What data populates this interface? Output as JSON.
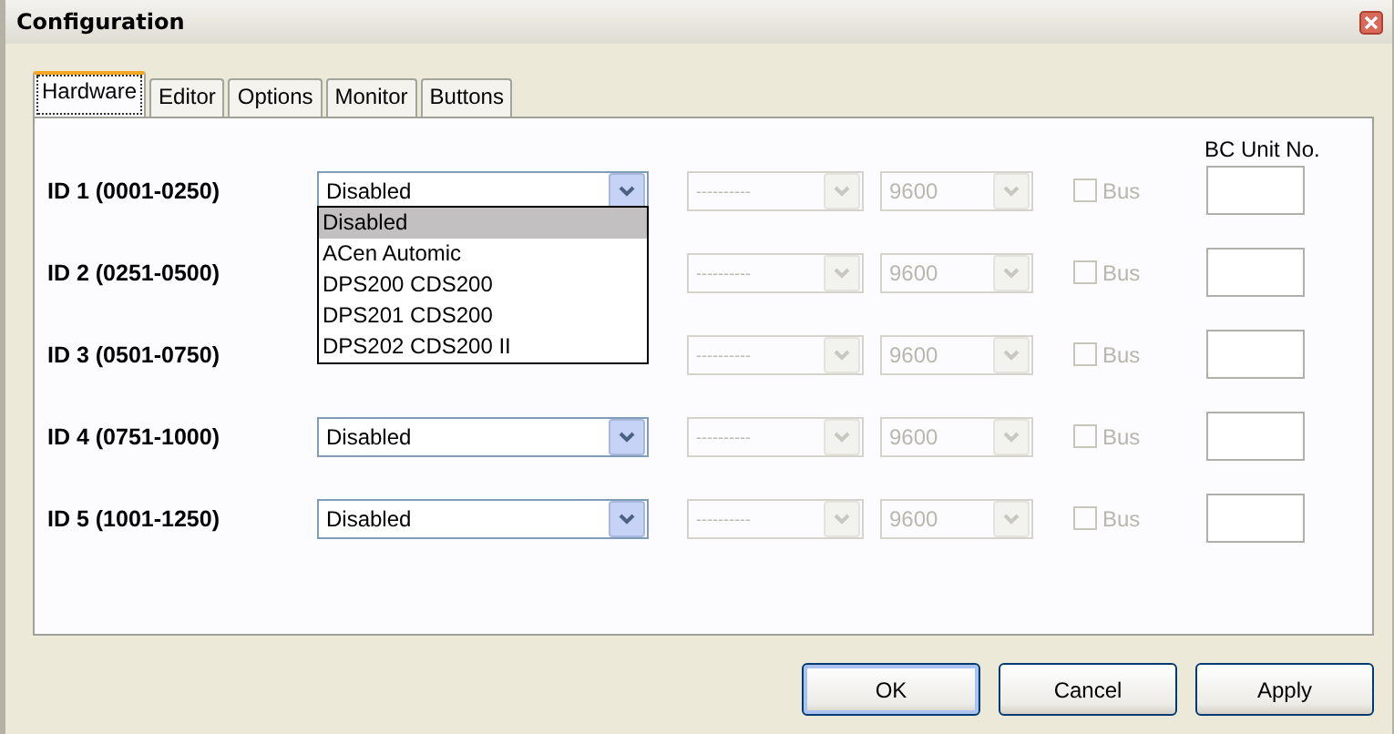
{
  "window": {
    "title": "Configuration"
  },
  "tabs": [
    {
      "label": "Hardware",
      "selected": true
    },
    {
      "label": "Editor",
      "selected": false
    },
    {
      "label": "Options",
      "selected": false
    },
    {
      "label": "Monitor",
      "selected": false
    },
    {
      "label": "Buttons",
      "selected": false
    }
  ],
  "column_header": "BC Unit No.",
  "rows": [
    {
      "label": "ID 1 (0001-0250)",
      "value": "Disabled",
      "expanded": true,
      "options": [
        {
          "label": "Disabled",
          "selected": true
        },
        {
          "label": "ACen Automic",
          "selected": false
        },
        {
          "label": "DPS200 CDS200",
          "selected": false
        },
        {
          "label": "DPS201 CDS200",
          "selected": false
        },
        {
          "label": "DPS202 CDS200 II",
          "selected": false
        }
      ],
      "port": "----------",
      "baud": "9600",
      "bus_label": "Bus",
      "bus": false,
      "disabled": true
    },
    {
      "label": "ID 2 (0251-0500)",
      "port": "----------",
      "baud": "9600",
      "bus_label": "Bus",
      "bus": false,
      "disabled": true
    },
    {
      "label": "ID 3 (0501-0750)",
      "port": "----------",
      "baud": "9600",
      "bus_label": "Bus",
      "bus": false,
      "disabled": true
    },
    {
      "label": "ID 4 (0751-1000)",
      "value": "Disabled",
      "expanded": false,
      "port": "----------",
      "baud": "9600",
      "bus_label": "Bus",
      "bus": false,
      "disabled": true
    },
    {
      "label": "ID 5 (1001-1250)",
      "value": "Disabled",
      "expanded": false,
      "port": "----------",
      "baud": "9600",
      "bus_label": "Bus",
      "bus": false,
      "disabled": true
    }
  ],
  "buttons": [
    "OK",
    "Cancel",
    "Apply"
  ]
}
